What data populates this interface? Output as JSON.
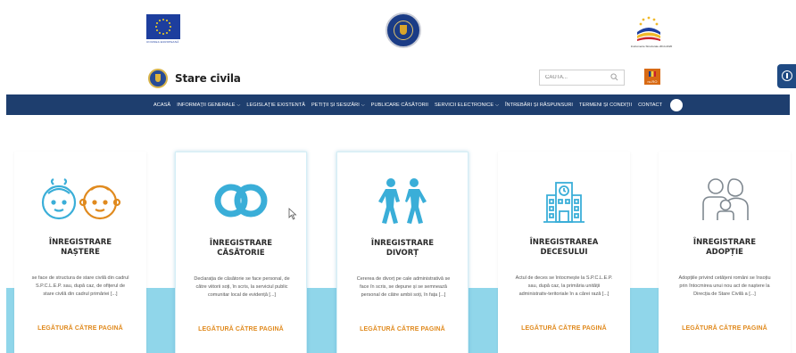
{
  "logos": {
    "eu_caption": "UNIUNEA EUROPEANĂ",
    "mdr_caption": "Instrumente Structurale 2014-2020",
    "colors": {
      "eu_blue": "#1d3e9e",
      "eu_star": "#f7d31a"
    }
  },
  "header": {
    "site_name": "Stare civila",
    "search_placeholder": "CAUTA...",
    "lang_code": "ro-RO"
  },
  "nav": {
    "items": [
      {
        "label": "ACASĂ",
        "dropdown": false
      },
      {
        "label": "INFORMAȚII GENERALE",
        "dropdown": true
      },
      {
        "label": "LEGISLAȚIE EXISTENTĂ",
        "dropdown": false
      },
      {
        "label": "PETIȚII ȘI SESIZĂRI",
        "dropdown": true
      },
      {
        "label": "PUBLICARE CĂSĂTORII",
        "dropdown": false
      },
      {
        "label": "SERVICII ELECTRONICE",
        "dropdown": true
      },
      {
        "label": "ÎNTREBĂRI ȘI RĂSPUNSURI",
        "dropdown": false
      },
      {
        "label": "TERMENI ȘI CONDIȚII",
        "dropdown": false
      },
      {
        "label": "CONTACT",
        "dropdown": false
      }
    ],
    "chevron": "⌵",
    "bg_color": "#1e3e6e"
  },
  "cards": [
    {
      "icon": "babies-icon",
      "title_line1": "ÎNREGISTRARE",
      "title_line2": "NAȘTERE",
      "desc": "se face de structura de stare civilă din cadrul S.P.C.L.E.P. sau, după caz, de ofițerul de stare civilă din cadrul primăriei [...]",
      "link": "LEGĂTURĂ CĂTRE PAGINĂ"
    },
    {
      "icon": "wedding-rings-icon",
      "title_line1": "ÎNREGISTRARE",
      "title_line2": "CĂSĂTORIE",
      "desc": "Declarația de căsătorie se face personal, de către viitorii soți, în scris, la serviciul public comunitar local de evidență [...]",
      "link": "LEGĂTURĂ CĂTRE PAGINĂ"
    },
    {
      "icon": "divorce-couple-icon",
      "title_line1": "ÎNREGISTRARE",
      "title_line2": "DIVORȚ",
      "desc": "Cererea de divorț pe cale administrativă se face în scris, se depune și se semnează personal de către ambii soți, în fața [...]",
      "link": "LEGĂTURĂ CĂTRE PAGINĂ"
    },
    {
      "icon": "hospital-building-icon",
      "title_line1": "ÎNREGISTRAREA",
      "title_line2": "DECESULUI",
      "desc": "Actul de deces se întocmește la S.P.C.L.E.P. sau, după caz, la primăria unității administrativ-teritoriale în a cărei rază [...]",
      "link": "LEGĂTURĂ CĂTRE PAGINĂ"
    },
    {
      "icon": "family-adoption-icon",
      "title_line1": "ÎNREGISTRARE",
      "title_line2": "ADOPȚIE",
      "desc": "Adopțiile privind cetățeni români se însoțiu prin întocmirea unui nou act de naștere la Direcția de Stare Civilă a [...]",
      "link": "LEGĂTURĂ CĂTRE PAGINĂ"
    }
  ],
  "colors": {
    "accent_blue": "#3aaed8",
    "link_orange": "#e08a1e",
    "band": "#90d6ea"
  }
}
